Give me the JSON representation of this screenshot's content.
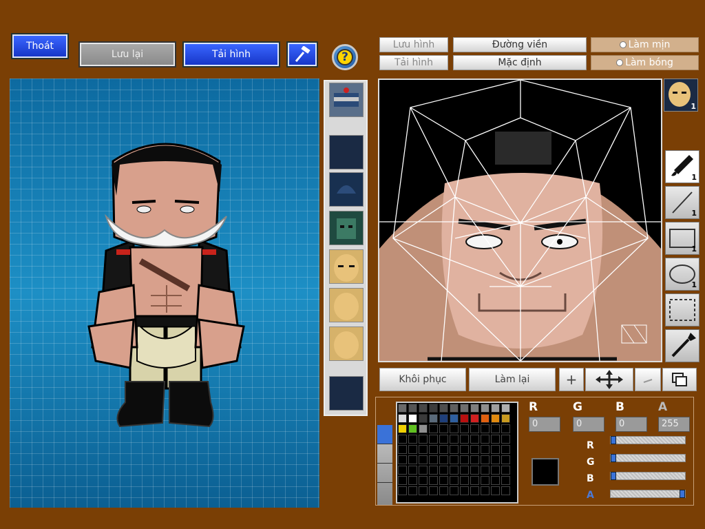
{
  "toolbar": {
    "exit_label": "Thoát",
    "save_label": "Lưu lại",
    "reload_label": "Tải hình",
    "help_symbol": "?"
  },
  "editor_toolbar": {
    "save_image_label": "Lưu hình",
    "load_image_label": "Tải hình",
    "outline_label": "Đường viền",
    "default_label": "Mặc định",
    "smooth_label": "Làm mịn",
    "shine_label": "Làm bóng"
  },
  "face_thumb_count": "1",
  "tools": [
    {
      "icon": "brush-icon",
      "count": "1"
    },
    {
      "icon": "line-icon",
      "count": "1"
    },
    {
      "icon": "rectangle-icon",
      "count": "1"
    },
    {
      "icon": "ellipse-icon",
      "count": "1"
    },
    {
      "icon": "selection-icon",
      "count": ""
    },
    {
      "icon": "eyedropper-icon",
      "count": ""
    }
  ],
  "bottom_buttons": {
    "restore_label": "Khôi phục",
    "redo_label": "Làm lại",
    "add_symbol": "+"
  },
  "color": {
    "r": "0",
    "g": "0",
    "b": "0",
    "a": "255",
    "r_label": "R",
    "g_label": "G",
    "b_label": "B",
    "a_label": "A",
    "current": "#000000",
    "palette": [
      "#6a6a6a",
      "#555555",
      "#474747",
      "#3c3c3c",
      "#4e4e4e",
      "#5f5f5f",
      "#6e6e6e",
      "#7e7e7e",
      "#8e8e8e",
      "#9e9e9e",
      "#aeaeae",
      "#dcdcdc",
      "#ffffff",
      "#3a3a3a",
      "#5a6a7a",
      "#1f3f7a",
      "#2f5f9f",
      "#b81010",
      "#d02020",
      "#e06010",
      "#e08a10",
      "#c89a20",
      "#f0d000",
      "#60c020",
      "#909090"
    ]
  }
}
